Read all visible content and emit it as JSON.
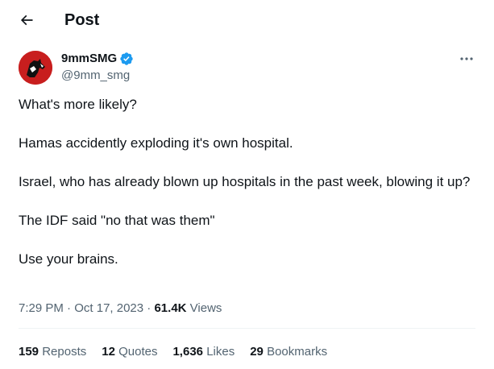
{
  "header": {
    "title": "Post",
    "back_icon": "arrow-left-icon"
  },
  "author": {
    "display_name": "9mmSMG",
    "handle": "@9mm_smg",
    "verified": true,
    "avatar_color": "#c81e1e"
  },
  "post": {
    "paragraphs": [
      "What's more likely?",
      "Hamas accidently exploding it's own hospital.",
      "Israel, who has already blown up hospitals in the past week, blowing it up?",
      "The IDF said \"no that was them\"",
      "Use your brains."
    ],
    "time": "7:29 PM",
    "separator": "·",
    "date": "Oct 17, 2023",
    "views_count": "61.4K",
    "views_label": "Views"
  },
  "stats": {
    "reposts": {
      "count": "159",
      "label": "Reposts"
    },
    "quotes": {
      "count": "12",
      "label": "Quotes"
    },
    "likes": {
      "count": "1,636",
      "label": "Likes"
    },
    "bookmarks": {
      "count": "29",
      "label": "Bookmarks"
    }
  },
  "colors": {
    "text_primary": "#0f1419",
    "text_secondary": "#536471",
    "verified_blue": "#1d9bf0",
    "divider": "#eff3f4"
  }
}
